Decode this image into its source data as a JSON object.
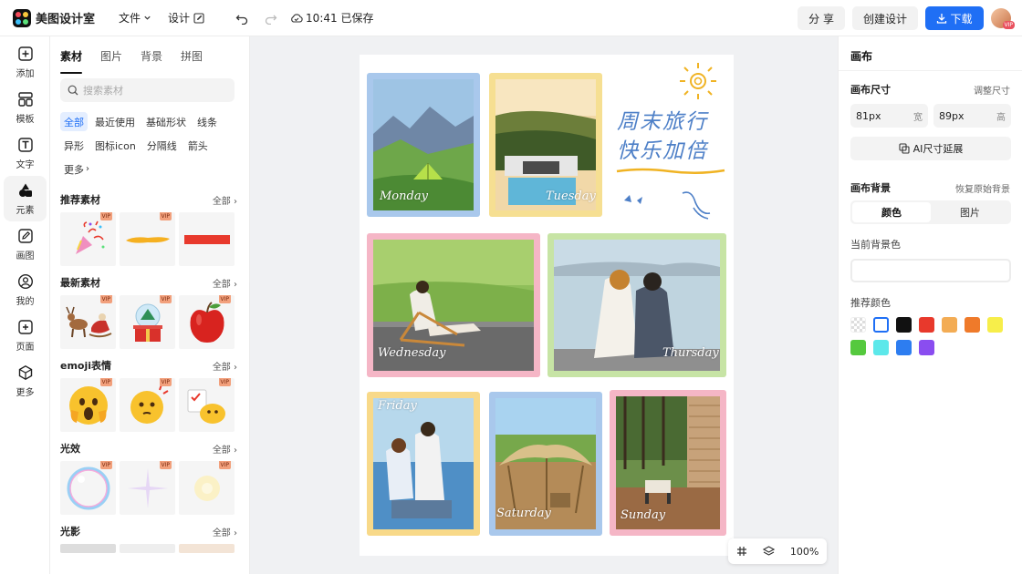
{
  "topbar": {
    "app_name": "美图设计室",
    "file_menu": "文件",
    "design_menu": "设计",
    "save_status": "10:41 已保存",
    "share_label": "分 享",
    "create_label": "创建设计",
    "download_label": "下载",
    "avatar_badge": "VIP"
  },
  "leftnav": {
    "items": [
      {
        "label": "添加",
        "icon": "plus-square-icon"
      },
      {
        "label": "模板",
        "icon": "template-icon"
      },
      {
        "label": "文字",
        "icon": "text-icon"
      },
      {
        "label": "元素",
        "icon": "shapes-icon"
      },
      {
        "label": "画图",
        "icon": "draw-icon"
      },
      {
        "label": "我的",
        "icon": "user-icon"
      },
      {
        "label": "页面",
        "icon": "page-add-icon"
      },
      {
        "label": "更多",
        "icon": "cube-icon"
      }
    ],
    "active_index": 3
  },
  "panel": {
    "tabs": [
      "素材",
      "图片",
      "背景",
      "拼图"
    ],
    "search_placeholder": "搜索素材",
    "chips": [
      "全部",
      "最近使用",
      "基础形状",
      "线条",
      "异形",
      "图标icon",
      "分隔线",
      "箭头",
      "更多"
    ],
    "sections": [
      {
        "title": "推荐素材",
        "all": "全部",
        "items": [
          "confetti-popper",
          "yellow-brush-stroke",
          "red-brush-stroke"
        ],
        "vip": [
          true,
          true,
          false
        ]
      },
      {
        "title": "最新素材",
        "all": "全部",
        "items": [
          "reindeer-sleigh",
          "snow-globe-gift",
          "red-apple"
        ],
        "vip": [
          true,
          true,
          true
        ]
      },
      {
        "title": "emoji表情",
        "all": "全部",
        "items": [
          "shocked-emoji",
          "thinking-emoji",
          "checklist-emoji"
        ],
        "vip": [
          true,
          true,
          true
        ]
      },
      {
        "title": "光效",
        "all": "全部",
        "items": [
          "bubble-light",
          "star-sparkle",
          "glow-flare"
        ],
        "vip": [
          true,
          true,
          true
        ]
      },
      {
        "title": "光影",
        "all": "全部",
        "items": [],
        "vip": []
      }
    ],
    "vip_badge": "VIP"
  },
  "canvas": {
    "headline_line1": "周末旅行",
    "headline_line2": "快乐加倍",
    "days": [
      "Monday",
      "Tuesday",
      "Wednesday",
      "Thursday",
      "Friday",
      "Saturday",
      "Sunday"
    ],
    "zoom": "100%"
  },
  "rpanel": {
    "title": "画布",
    "size_label": "画布尺寸",
    "size_link": "调整尺寸",
    "width_value": "81px",
    "width_unit": "宽",
    "height_value": "89px",
    "height_unit": "高",
    "ai_button": "AI尺寸延展",
    "bg_label": "画布背景",
    "bg_reset": "恢复原始背景",
    "seg_color": "颜色",
    "seg_image": "图片",
    "current_bg_label": "当前背景色",
    "recommend_label": "推荐颜色",
    "colors": [
      "transparent",
      "#ffffff",
      "#111111",
      "#e8392c",
      "#f3ac54",
      "#ef7a2a",
      "#f7ee4a",
      "#55c93e",
      "#5ce8ea",
      "#2d7df0",
      "#8a4df0"
    ]
  }
}
